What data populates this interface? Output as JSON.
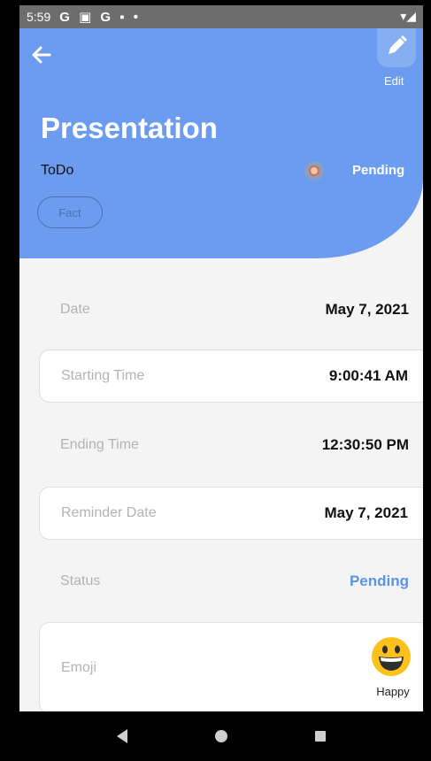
{
  "status_bar": {
    "time": "5:59",
    "notifications": "G ▣ G ▪ •",
    "signal": "▾◢"
  },
  "header": {
    "back_icon": "arrow-left-icon",
    "edit_icon": "pencil-icon",
    "edit_label": "Edit",
    "title": "Presentation",
    "category": "ToDo",
    "status": "Pending",
    "tag": "Fact",
    "color": "#6c9cef"
  },
  "details": {
    "date": {
      "label": "Date",
      "value": "May 7, 2021"
    },
    "start": {
      "label": "Starting Time",
      "value": "9:00:41 AM"
    },
    "end": {
      "label": "Ending Time",
      "value": "12:30:50 PM"
    },
    "reminder": {
      "label": "Reminder Date",
      "value": "May 7, 2021"
    },
    "status": {
      "label": "Status",
      "value": "Pending",
      "color": "#5b93e8"
    },
    "emoji": {
      "label": "Emoji",
      "value": "Happy",
      "icon": "grinning-face-icon"
    }
  },
  "navbar": {
    "back": "triangle-back-icon",
    "home": "circle-home-icon",
    "recent": "square-recent-icon"
  }
}
